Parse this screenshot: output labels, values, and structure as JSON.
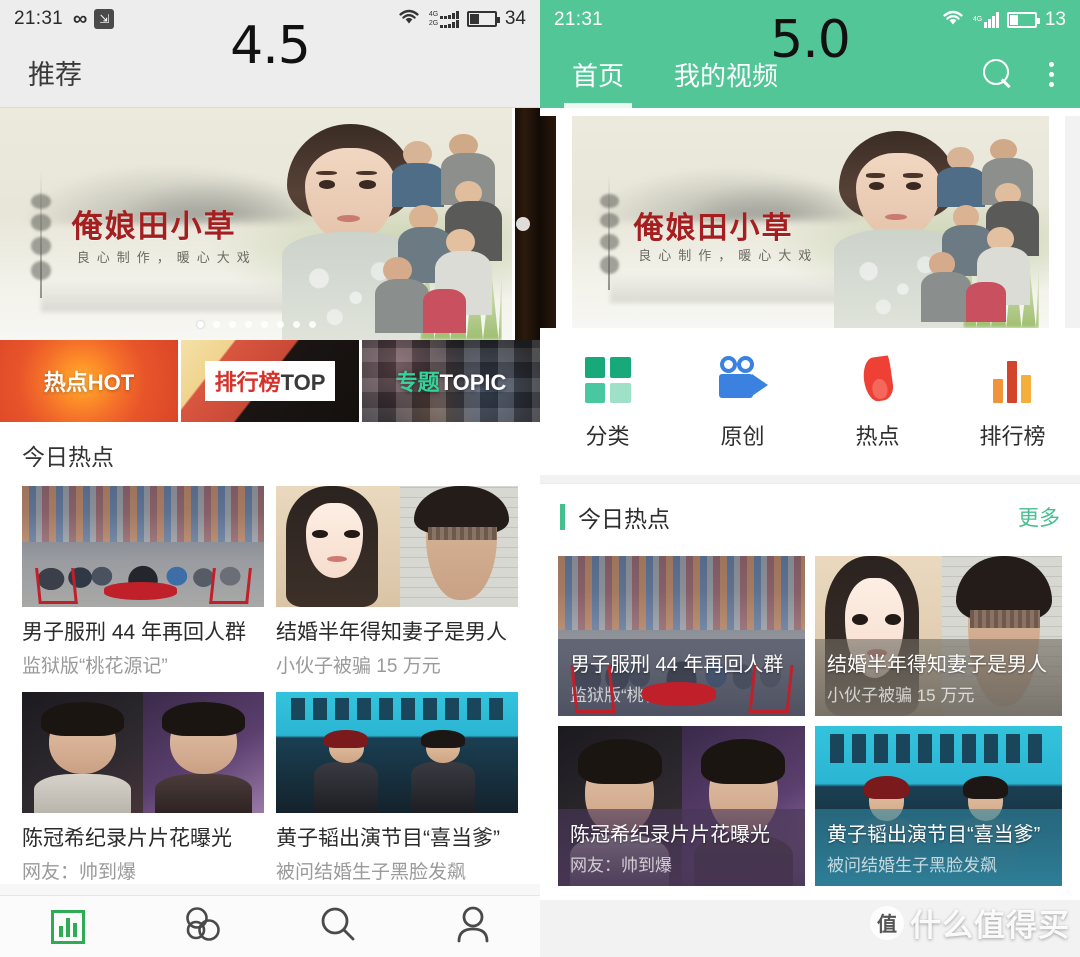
{
  "left_phone": {
    "status_bar": {
      "time": "21:31",
      "infinity_icon": "infinity-icon",
      "share_icon": "share-badge-icon",
      "wifi_icon": "wifi-icon",
      "signal_4g_label": "4G",
      "signal_2g_label": "2G",
      "battery_percent": "34"
    },
    "title_bar": {
      "title": "推荐"
    },
    "version_label": "4.5",
    "banner": {
      "title": "俺娘田小草",
      "subtitle": "良心制作，暖心大戏",
      "dot_count": 8,
      "active_dot_index": 0
    },
    "tiles": [
      {
        "name": "hot",
        "cn": "热点",
        "en": "HOT"
      },
      {
        "name": "top",
        "cn": "排行榜",
        "en": "TOP"
      },
      {
        "name": "topic",
        "cn": "专题",
        "en": "TOPIC"
      }
    ],
    "section": {
      "title": "今日热点"
    },
    "news": [
      {
        "title": "男子服刑 44 年再回人群",
        "subtitle": "监狱版“桃花源记”"
      },
      {
        "title": "结婚半年得知妻子是男人",
        "subtitle": "小伙子被骗 15 万元"
      },
      {
        "title": "陈冠希纪录片片花曝光",
        "subtitle": "网友：帅到爆"
      },
      {
        "title": "黄子韬出演节目“喜当爹”",
        "subtitle": "被问结婚生子黑脸发飙"
      }
    ],
    "tab_bar": [
      {
        "name": "rank-tab",
        "icon": "bar-chart-icon",
        "active": true
      },
      {
        "name": "discover-tab",
        "icon": "three-circles-icon",
        "active": false
      },
      {
        "name": "search-tab",
        "icon": "search-icon",
        "active": false
      },
      {
        "name": "profile-tab",
        "icon": "person-icon",
        "active": false
      }
    ]
  },
  "right_phone": {
    "status_bar": {
      "time": "21:31",
      "wifi_icon": "wifi-icon",
      "signal_4g_label": "4G",
      "battery_percent": "13"
    },
    "version_label": "5.0",
    "app_bar": {
      "tabs": [
        {
          "label": "首页",
          "active": true
        },
        {
          "label": "我的视频",
          "active": false
        }
      ],
      "search_icon": "search-icon",
      "overflow_icon": "kebab-menu-icon"
    },
    "banner": {
      "title": "俺娘田小草",
      "subtitle": "良心制作，暖心大戏"
    },
    "quick_actions": [
      {
        "label": "分类",
        "icon": "grid-icon",
        "color": "#18a97b"
      },
      {
        "label": "原创",
        "icon": "video-camera-icon",
        "color": "#3b82e0"
      },
      {
        "label": "热点",
        "icon": "flame-icon",
        "color": "#ef4035"
      },
      {
        "label": "排行榜",
        "icon": "bar-chart-icon",
        "color": "#e8792a"
      }
    ],
    "section": {
      "title": "今日热点",
      "more_label": "更多",
      "accent": "#46bf8e"
    },
    "news": [
      {
        "title": "男子服刑 44 年再回人群",
        "subtitle": "监狱版“桃花源记”"
      },
      {
        "title": "结婚半年得知妻子是男人",
        "subtitle": "小伙子被骗 15 万元"
      },
      {
        "title": "陈冠希纪录片片花曝光",
        "subtitle": "网友：帅到爆"
      },
      {
        "title": "黄子韬出演节目“喜当爹”",
        "subtitle": "被问结婚生子黑脸发飙"
      }
    ],
    "theme_color": "#53c698"
  },
  "watermark": {
    "logo_char": "值",
    "text": "什么值得买"
  }
}
